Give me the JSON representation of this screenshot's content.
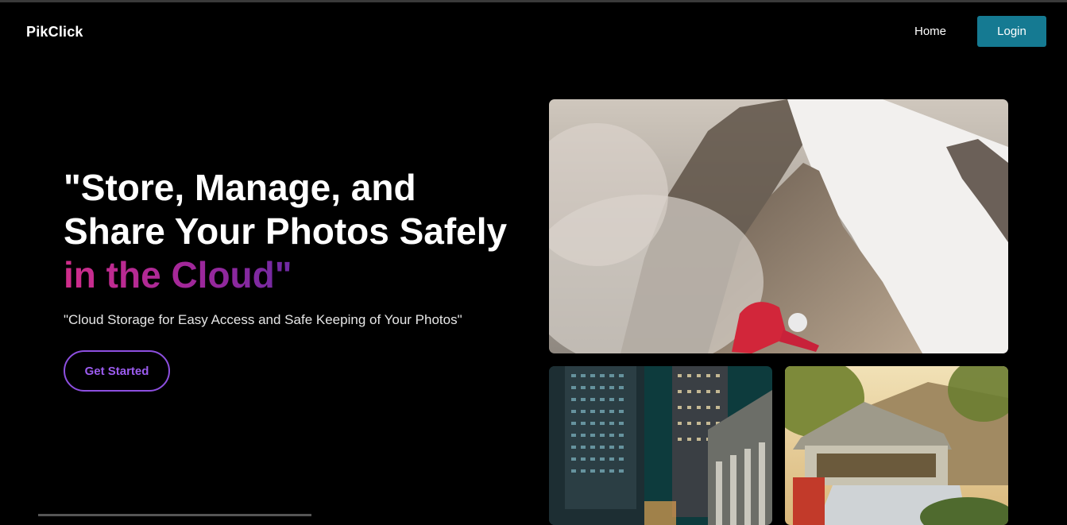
{
  "nav": {
    "brand": "PikClick",
    "home_label": "Home",
    "login_label": "Login"
  },
  "hero": {
    "title_line1": "\"Store, Manage, and",
    "title_line2": "Share Your Photos Safely",
    "title_line3": "in the Cloud\"",
    "subtitle": "\"Cloud Storage for Easy Access and Safe Keeping of Your Photos\"",
    "cta_label": "Get Started"
  },
  "gallery": [
    {
      "name": "mountain-climber-photo",
      "icon": "photo-mountain"
    },
    {
      "name": "city-night-photo",
      "icon": "photo-city"
    },
    {
      "name": "rooftop-tent-photo",
      "icon": "photo-tent"
    }
  ],
  "colors": {
    "login_bg": "#157a92",
    "cta_border": "#8d4fe0",
    "gradient_start": "#d02d8a",
    "gradient_end": "#6e2aa3"
  }
}
